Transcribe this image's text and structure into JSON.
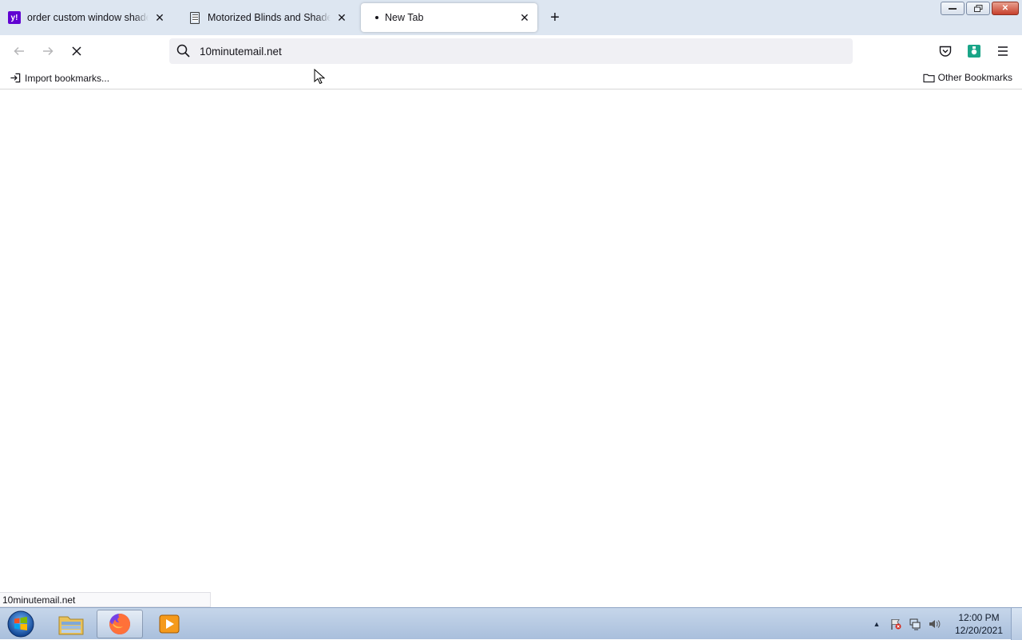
{
  "browser": {
    "tabs": [
      {
        "title": "order custom window shade - Y",
        "favicon": "yahoo-icon",
        "active": false
      },
      {
        "title": "Motorized Blinds and Shades | S",
        "favicon": "page-icon",
        "active": false
      },
      {
        "title": "New Tab",
        "favicon": "loading-dot",
        "active": true
      }
    ],
    "new_tab_symbol": "+",
    "close_symbol": "✕",
    "window_controls": {
      "minimize": "—",
      "restore": "❐",
      "close": "✕"
    }
  },
  "navbar": {
    "url_value": "10minutemail.net",
    "back_symbol": "←",
    "forward_symbol": "→",
    "stop_symbol": "✕"
  },
  "bookmarks": {
    "import_label": "Import bookmarks...",
    "other_label": "Other Bookmarks"
  },
  "status": {
    "link_text": "10minutemail.net"
  },
  "taskbar": {
    "apps": [
      "explorer-icon",
      "firefox-icon",
      "media-player-icon"
    ],
    "active_app": "firefox-icon",
    "clock_time": "12:00 PM",
    "clock_date": "12/20/2021",
    "tray_arrow": "▲"
  },
  "colors": {
    "tabstrip": "#dde6f1",
    "urlbar": "#f0f0f4",
    "yahoo": "#6001d2",
    "taskbar": "#b4c8e2"
  }
}
